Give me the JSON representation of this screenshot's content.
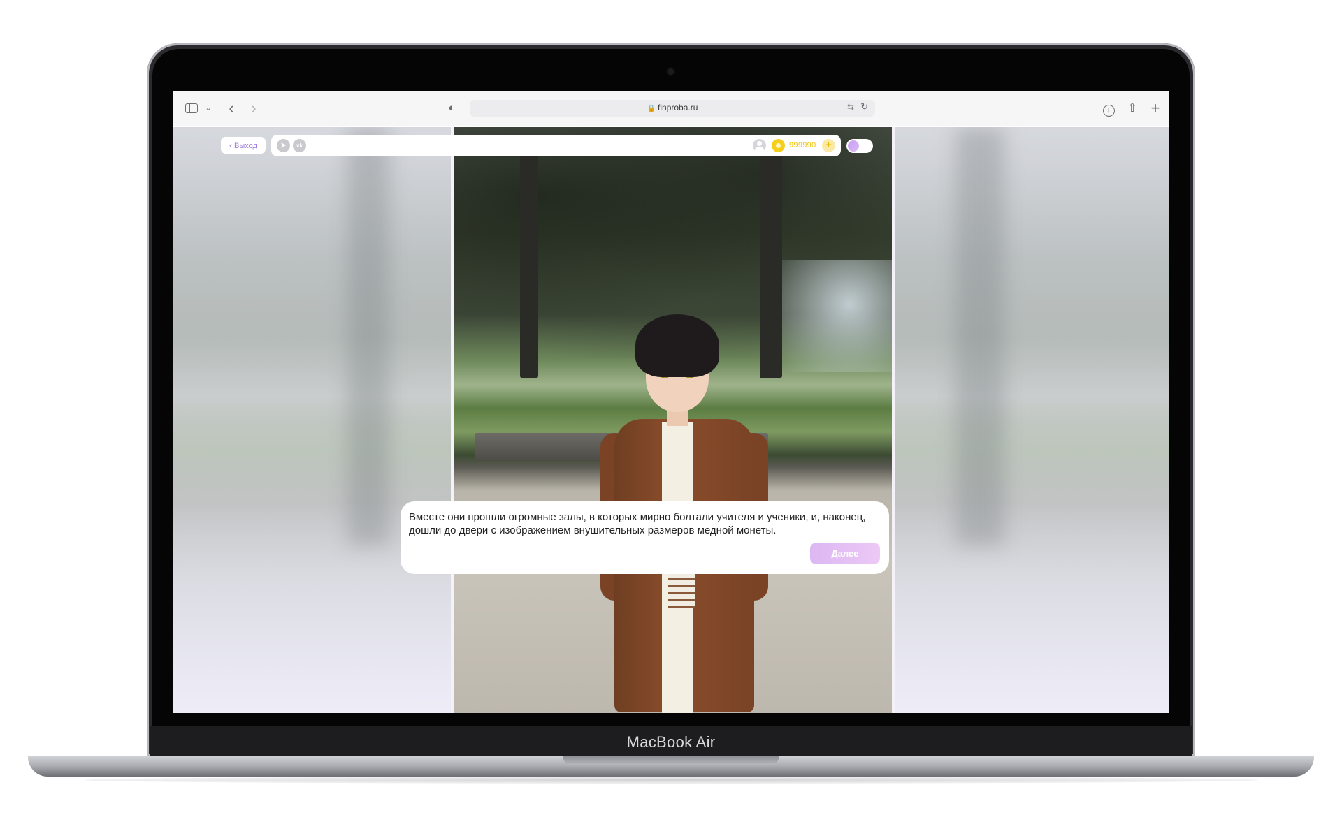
{
  "device": {
    "label": "MacBook Air"
  },
  "browser": {
    "url": "finproba.ru"
  },
  "game": {
    "exit_label": "Выход",
    "coins": "999990",
    "add_coins_symbol": "+"
  },
  "dialog": {
    "text": "Вместе они прошли огромные залы, в которых мирно болтали учителя и ученики, и, наконец, дошли до двери с изображением внушительных размеров медной монеты.",
    "next_label": "Далее"
  },
  "colors": {
    "accent": "#c99ff1",
    "coin": "#f4cf1d",
    "exit_text": "#9d7cd8"
  }
}
